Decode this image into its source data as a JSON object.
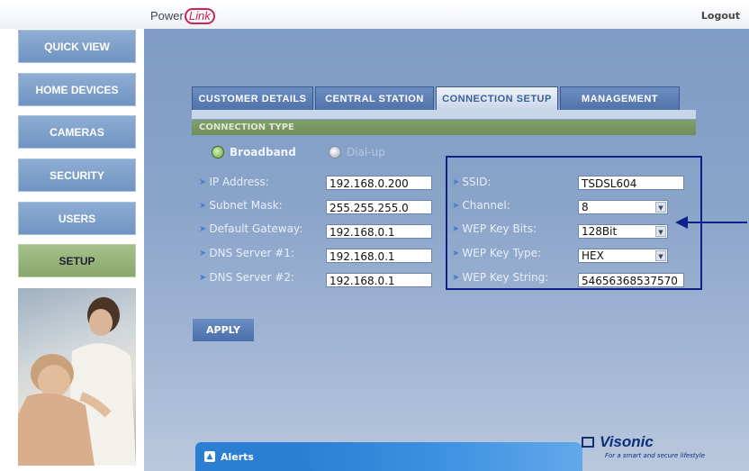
{
  "header": {
    "logo_text": "Power",
    "logo_link": "Link",
    "logout": "Logout"
  },
  "sidebar": {
    "items": [
      {
        "label": "QUICK VIEW"
      },
      {
        "label": "HOME DEVICES"
      },
      {
        "label": "CAMERAS"
      },
      {
        "label": "SECURITY"
      },
      {
        "label": "USERS"
      },
      {
        "label": "SETUP",
        "active": true
      }
    ]
  },
  "tabs": [
    {
      "label": "CUSTOMER DETAILS"
    },
    {
      "label": "CENTRAL STATION"
    },
    {
      "label": "CONNECTION SETUP",
      "active": true
    },
    {
      "label": "MANAGEMENT"
    }
  ],
  "connection_type": {
    "title": "CONNECTION TYPE",
    "options": [
      {
        "label": "Broadband",
        "selected": true
      },
      {
        "label": "Dial-up",
        "selected": false
      }
    ]
  },
  "network": {
    "ip_label": "IP Address:",
    "ip_value": "192.168.0.200",
    "subnet_label": "Subnet Mask:",
    "subnet_value": "255.255.255.0",
    "gateway_label": "Default Gateway:",
    "gateway_value": "192.168.0.1",
    "dns1_label": "DNS Server #1:",
    "dns1_value": "192.168.0.1",
    "dns2_label": "DNS Server #2:",
    "dns2_value": "192.168.0.1"
  },
  "wireless": {
    "ssid_label": "SSID:",
    "ssid_value": "TSDSL604",
    "channel_label": "Channel:",
    "channel_value": "8",
    "wep_bits_label": "WEP Key Bits:",
    "wep_bits_value": "128Bit",
    "wep_type_label": "WEP Key Type:",
    "wep_type_value": "HEX",
    "wep_string_label": "WEP Key String:",
    "wep_string_value": "54656368537570"
  },
  "apply_label": "APPLY",
  "alerts_label": "Alerts",
  "brand": {
    "name": "Visonic",
    "tagline": "For a smart and secure lifestyle"
  },
  "colors": {
    "accent_blue": "#4f72aa",
    "active_green": "#88a66b",
    "highlight_box": "#10208a"
  }
}
